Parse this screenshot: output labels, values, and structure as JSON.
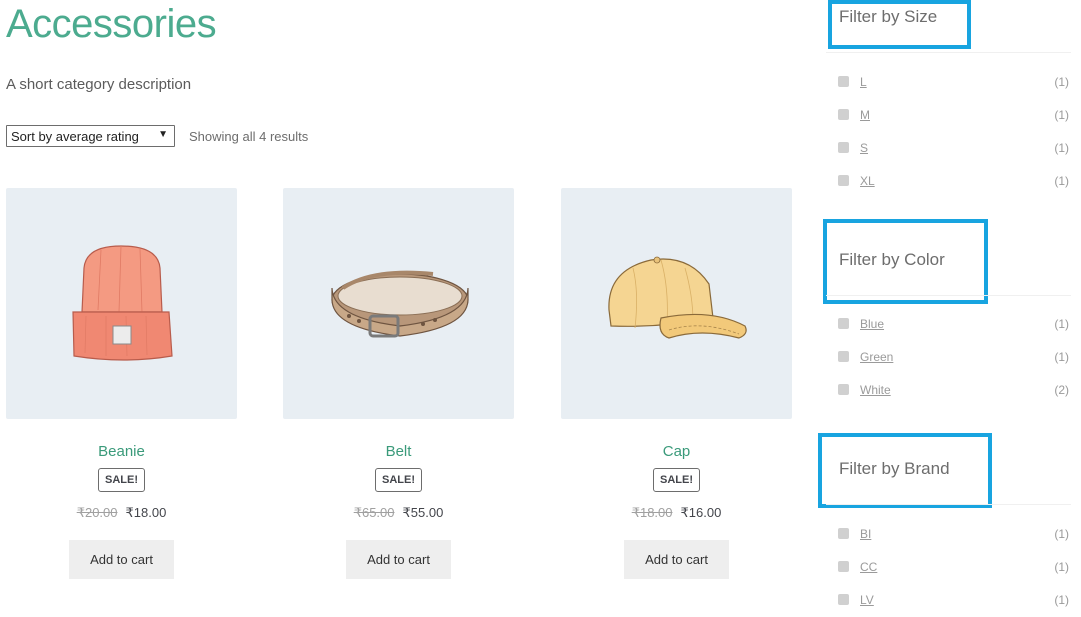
{
  "category": {
    "title": "Accessories",
    "description": "A short category description"
  },
  "toolbar": {
    "sort_selected": "Sort by average rating",
    "result_count": "Showing all 4 results"
  },
  "products": [
    {
      "name": "Beanie",
      "badge": "SALE!",
      "old_price": "₹20.00",
      "price": "₹18.00",
      "button": "Add to cart",
      "image_icon": "beanie-image",
      "image_color": "#f08a72"
    },
    {
      "name": "Belt",
      "badge": "SALE!",
      "old_price": "₹65.00",
      "price": "₹55.00",
      "button": "Add to cart",
      "image_icon": "belt-image",
      "image_color": "#c9ab90"
    },
    {
      "name": "Cap",
      "badge": "SALE!",
      "old_price": "₹18.00",
      "price": "₹16.00",
      "button": "Add to cart",
      "image_icon": "cap-image",
      "image_color": "#f3d28a"
    }
  ],
  "filters": {
    "size": {
      "title": "Filter by Size",
      "items": [
        {
          "label": "L",
          "count": "(1)"
        },
        {
          "label": "M",
          "count": "(1)"
        },
        {
          "label": "S",
          "count": "(1)"
        },
        {
          "label": "XL",
          "count": "(1)"
        }
      ]
    },
    "color": {
      "title": "Filter by Color",
      "items": [
        {
          "label": "Blue",
          "count": "(1)"
        },
        {
          "label": "Green",
          "count": "(1)"
        },
        {
          "label": "White",
          "count": "(2)"
        }
      ]
    },
    "brand": {
      "title": "Filter by Brand",
      "items": [
        {
          "label": "BI",
          "count": "(1)"
        },
        {
          "label": "CC",
          "count": "(1)"
        },
        {
          "label": "LV",
          "count": "(1)"
        }
      ]
    }
  },
  "colors": {
    "accent": "#4cab8f",
    "highlight_box": "#18a4e0",
    "thumb_bg": "#e8eef3"
  }
}
